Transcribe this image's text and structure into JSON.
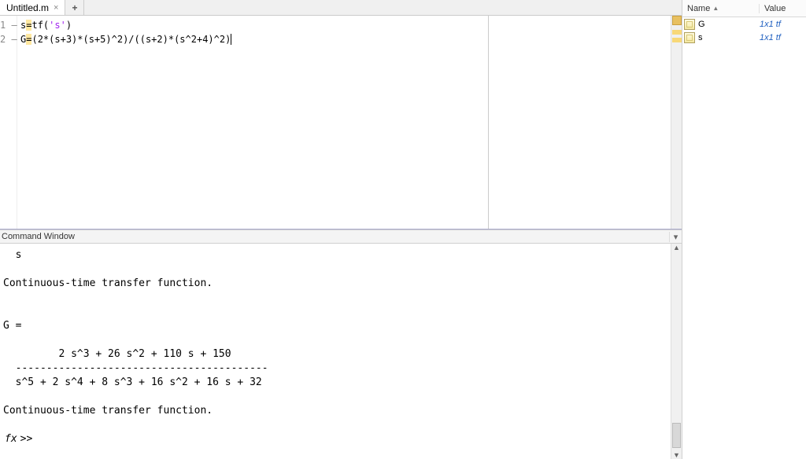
{
  "tabs": {
    "active": "Untitled.m",
    "plus_label": "+"
  },
  "editor": {
    "lines": [
      {
        "num": "1",
        "prefix": "s",
        "eq": "=",
        "after_eq": "tf(",
        "str": "'s'",
        "tail": ")"
      },
      {
        "num": "2",
        "prefix": "G",
        "eq": "=",
        "after_eq": "(2*(s+3)*(s+5)^2)/((s+2)*(s^2+4)^2)",
        "str": "",
        "tail": ""
      }
    ]
  },
  "command_window": {
    "title": "Command Window",
    "output": "  s\n\nContinuous-time transfer function.\n\n\nG =\n\n         2 s^3 + 26 s^2 + 110 s + 150\n  -----------------------------------------\n  s^5 + 2 s^4 + 8 s^3 + 16 s^2 + 16 s + 32\n\nContinuous-time transfer function.\n",
    "prompt_fx": "fx",
    "prompt": ">> "
  },
  "workspace": {
    "col_name": "Name",
    "col_value": "Value",
    "vars": [
      {
        "name": "G",
        "value": "1x1 tf"
      },
      {
        "name": "s",
        "value": "1x1 tf"
      }
    ]
  }
}
